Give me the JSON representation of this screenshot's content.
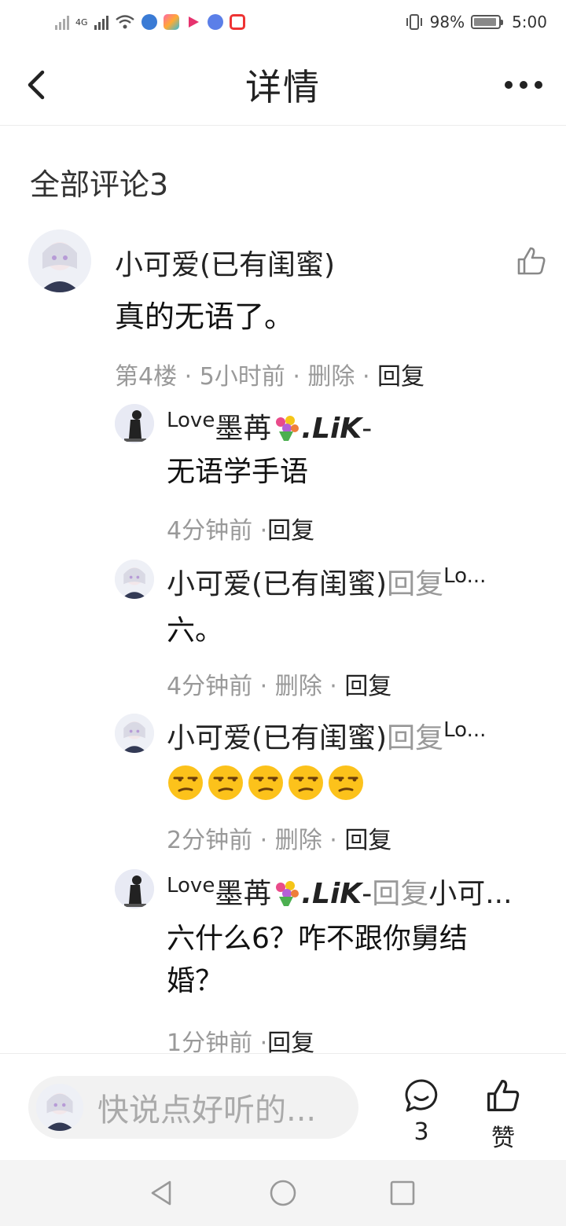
{
  "status_bar": {
    "network": "4G",
    "battery": "98%",
    "time": "5:00"
  },
  "nav": {
    "title": "详情"
  },
  "comments": {
    "header": "全部评论3",
    "main": {
      "author": "小可爱(已有闺蜜)",
      "text": "真的无语了。",
      "floor": "第4楼",
      "time": "5小时前",
      "delete": "删除",
      "reply": "回复"
    },
    "replies": [
      {
        "author_prefix": "Love",
        "author_name": "墨苒",
        "author_suffix": ".LiK",
        "author_dash": "-",
        "text": "无语学手语",
        "time": "4分钟前",
        "reply": "回复"
      },
      {
        "author": "小可爱(已有闺蜜)",
        "reply_word": "回复",
        "target": "Lo...",
        "text": "六。",
        "time": "4分钟前",
        "delete": "删除",
        "reply": "回复"
      },
      {
        "author": "小可爱(已有闺蜜)",
        "reply_word": "回复",
        "target": "Lo...",
        "text": "",
        "emoji_count": 5,
        "emoji_name": "unamused-face-emoji",
        "time": "2分钟前",
        "delete": "删除",
        "reply": "回复"
      },
      {
        "author_prefix": "Love",
        "author_name": "墨苒",
        "author_suffix": ".LiK",
        "author_dash": "-",
        "reply_word": "回复",
        "target": "小可...",
        "text": "六什么6？咋不跟你舅结婚？",
        "time": "1分钟前",
        "reply": "回复"
      }
    ]
  },
  "bottom_bar": {
    "input_placeholder": "快说点好听的...",
    "comment_count": "3",
    "like_label": "赞"
  },
  "colors": {
    "text": "#222222",
    "muted": "#999999",
    "divider": "#ececec"
  }
}
